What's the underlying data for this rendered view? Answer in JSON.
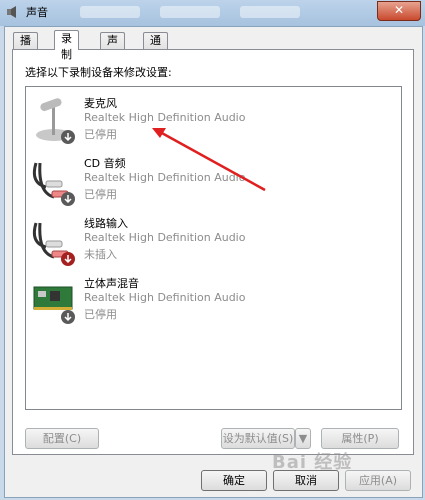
{
  "window": {
    "title": "声音"
  },
  "tabs": [
    {
      "label": "播放"
    },
    {
      "label": "录制"
    },
    {
      "label": "声音"
    },
    {
      "label": "通信"
    }
  ],
  "instruction": "选择以下录制设备来修改设置:",
  "devices": [
    {
      "name": "麦克风",
      "description": "Realtek High Definition Audio",
      "status": "已停用",
      "icon": "microphone-icon"
    },
    {
      "name": "CD 音频",
      "description": "Realtek High Definition Audio",
      "status": "已停用",
      "icon": "cd-audio-cable-icon"
    },
    {
      "name": "线路输入",
      "description": "Realtek High Definition Audio",
      "status": "未插入",
      "icon": "line-in-cable-icon"
    },
    {
      "name": "立体声混音",
      "description": "Realtek High Definition Audio",
      "status": "已停用",
      "icon": "sound-card-icon"
    }
  ],
  "buttons": {
    "configure": "配置(C)",
    "set_default": "设为默认值(S)",
    "properties": "属性(P)",
    "ok": "确定",
    "cancel": "取消",
    "apply": "应用(A)"
  },
  "watermark": "Bai 经验",
  "colors": {
    "annotation_arrow": "#e02020",
    "disabled_text": "#8c8c8c"
  }
}
